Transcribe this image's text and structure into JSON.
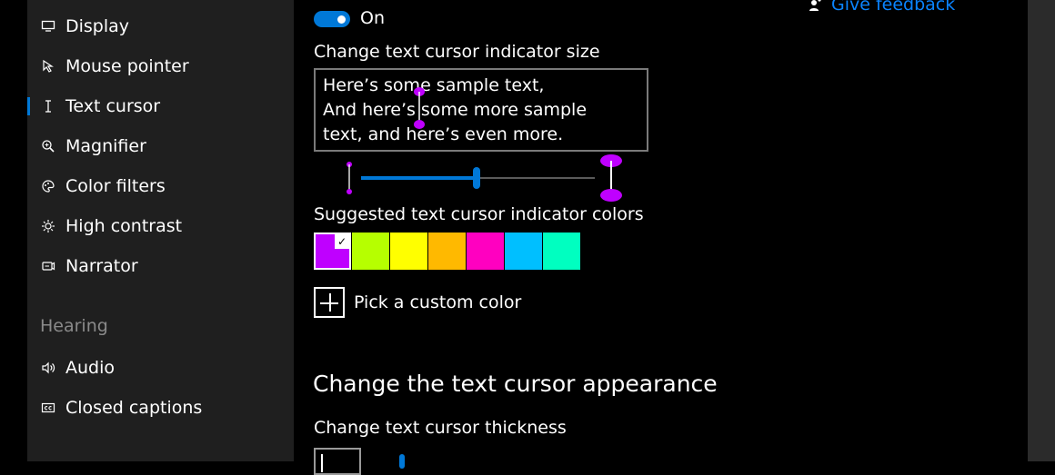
{
  "sidebar": {
    "items": [
      {
        "label": "Display",
        "icon": "display-icon",
        "selected": false
      },
      {
        "label": "Mouse pointer",
        "icon": "mouse-pointer-icon",
        "selected": false
      },
      {
        "label": "Text cursor",
        "icon": "text-cursor-icon",
        "selected": true
      },
      {
        "label": "Magnifier",
        "icon": "magnifier-icon",
        "selected": false
      },
      {
        "label": "Color filters",
        "icon": "color-filters-icon",
        "selected": false
      },
      {
        "label": "High contrast",
        "icon": "high-contrast-icon",
        "selected": false
      },
      {
        "label": "Narrator",
        "icon": "narrator-icon",
        "selected": false
      }
    ],
    "hearing_heading": "Hearing",
    "hearing_items": [
      {
        "label": "Audio",
        "icon": "audio-icon"
      },
      {
        "label": "Closed captions",
        "icon": "closed-captions-icon"
      }
    ]
  },
  "main": {
    "toggle": {
      "state_label": "On",
      "on": true
    },
    "feedback_label": "Give feedback",
    "indicator_size_label": "Change text cursor indicator size",
    "sample_text": [
      "Here’s some sample text,",
      "And here’s some more sample",
      "text, and here’s even more."
    ],
    "size_slider_fraction": 0.5,
    "suggested_colors_label": "Suggested text cursor indicator colors",
    "swatches": [
      "#bf00ff",
      "#b6ff00",
      "#ffff00",
      "#ffb900",
      "#ff00c0",
      "#00bfff",
      "#00ffc0"
    ],
    "selected_swatch": 0,
    "custom_color_label": "Pick a custom color",
    "appearance_title": "Change the text cursor appearance",
    "thickness_label": "Change text cursor thickness"
  },
  "colors": {
    "accent": "#0078d7",
    "indicator": "#bf00ff",
    "link": "#0a84ff"
  }
}
